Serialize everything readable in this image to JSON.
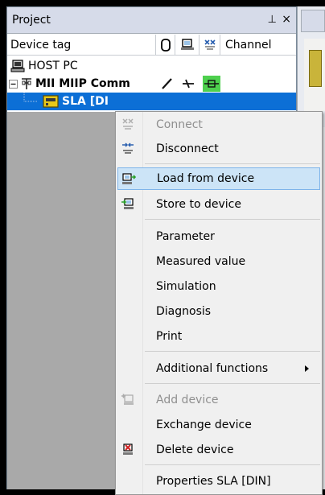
{
  "panel": {
    "title": "Project",
    "pin_glyph": "⊥",
    "close_glyph": "×",
    "columns": {
      "device_tag": "Device tag",
      "channel": "Channel"
    },
    "rows": [
      {
        "label": "HOST PC"
      },
      {
        "label": "MII MIIP Comm"
      },
      {
        "label": "SLA [DI"
      }
    ]
  },
  "context_menu": {
    "items": [
      {
        "label": "Connect",
        "enabled": false,
        "icon": "connect-icon"
      },
      {
        "label": "Disconnect",
        "enabled": true,
        "icon": "disconnect-icon"
      },
      {
        "label": "Load from device",
        "enabled": true,
        "highlighted": true,
        "icon": "load-from-device-icon"
      },
      {
        "label": "Store to device",
        "enabled": true,
        "icon": "store-to-device-icon"
      },
      {
        "label": "Parameter",
        "enabled": true
      },
      {
        "label": "Measured value",
        "enabled": true
      },
      {
        "label": "Simulation",
        "enabled": true
      },
      {
        "label": "Diagnosis",
        "enabled": true
      },
      {
        "label": "Print",
        "enabled": true
      },
      {
        "label": "Additional functions",
        "enabled": true,
        "submenu": true
      },
      {
        "label": "Add device",
        "enabled": false,
        "icon": "add-device-icon"
      },
      {
        "label": "Exchange device",
        "enabled": true
      },
      {
        "label": "Delete device",
        "enabled": true,
        "icon": "delete-device-icon"
      },
      {
        "label": "Properties SLA [DIN]",
        "enabled": true
      }
    ]
  },
  "colors": {
    "selection": "#0c6fd6",
    "menu_highlight": "#cce4f7",
    "menu_highlight_border": "#7eb4ea",
    "disabled_text": "#8f8f8f",
    "status_green": "#4ed04e"
  }
}
